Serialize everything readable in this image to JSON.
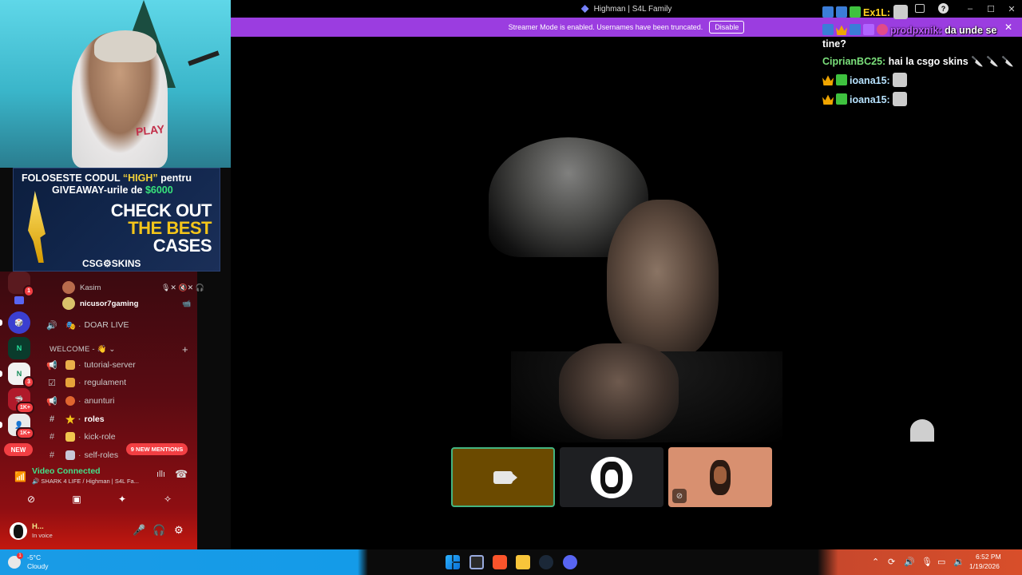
{
  "window": {
    "title": "Highman | S4L Family",
    "controls": {
      "minimize": "–",
      "maximize": "☐",
      "close": "✕"
    },
    "help": "?"
  },
  "banner": {
    "text": "Streamer Mode is enabled. Usernames have been truncated.",
    "button": "Disable",
    "close": "✕"
  },
  "chat": {
    "messages": [
      {
        "name": "Ex1L:",
        "text": ""
      },
      {
        "name": "prodpxnik:",
        "text": "da unde se tine?"
      },
      {
        "name": "CiprianBC25:",
        "text": "hai la csgo skins 🔪 🔪 🔪"
      },
      {
        "name": "ioana15:",
        "text": ""
      },
      {
        "name": "ioana15:",
        "text": ""
      }
    ]
  },
  "webcam": {
    "shirt_text": "PLAY"
  },
  "sponsor": {
    "line1_a": "FOLOSESTE CODUL ",
    "line1_code": "“HIGH”",
    "line1_b": " pentru",
    "line2_a": "GIVEAWAY-urile de ",
    "line2_amount": "$6000",
    "big1": "CHECK OUT",
    "big2": "THE BEST",
    "big3": "CASES",
    "brand": "CSG⚙SKINS"
  },
  "sidebar": {
    "voice_users": [
      {
        "name": "Kasim",
        "icons": "🎙✕ 🔇✕ 🎧"
      },
      {
        "name": "nicusor7gaming",
        "icons": "📹"
      }
    ],
    "channels_top": [
      {
        "icon": "🔊",
        "label": "DOAR LIVE"
      }
    ],
    "category": "WELCOME - 👋 ⌄",
    "channels": [
      {
        "icon": "📢",
        "emoji_color": "#e8b04a",
        "label": "tutorial-server",
        "bold": false
      },
      {
        "icon": "☑",
        "emoji_color": "#e6a33a",
        "label": "regulament",
        "bold": false
      },
      {
        "icon": "📢",
        "emoji_color": "#e0662f",
        "label": "anunturi",
        "bold": false
      },
      {
        "icon": "#",
        "emoji_color": "#f5c518",
        "label": "roles",
        "bold": true
      },
      {
        "icon": "#",
        "emoji_color": "#f0c64e",
        "label": "kick-role",
        "bold": false
      },
      {
        "icon": "#",
        "emoji_color": "#c8c8d8",
        "label": "self-roles",
        "bold": false
      }
    ],
    "mentions_badge": "9 NEW MENTIONS",
    "new_badge": "NEW",
    "server_counts": [
      "1",
      "3",
      "1K+",
      "1K+"
    ]
  },
  "voice_panel": {
    "status": "Video Connected",
    "subtitle": "🔊 SHARK 4 LIFE / Highman | S4L Fa...",
    "wave_icon": "ıllı",
    "disconnect_icon": "☎"
  },
  "user": {
    "name": "H...",
    "status": "In voice"
  },
  "taskbar": {
    "weather_temp": "-5°C",
    "weather_desc": "Cloudy",
    "weather_alert": "1",
    "time": "6:52 PM",
    "date": "1/19/2026"
  },
  "colors": {
    "banner": "#9b3de0",
    "accent_green": "#43b581",
    "mention_red": "#f23f43"
  }
}
